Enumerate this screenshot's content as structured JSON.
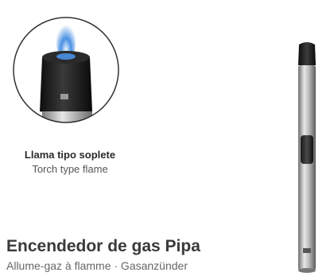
{
  "feature": {
    "title": "Llama tipo soplete",
    "subtitle": "Torch type flame"
  },
  "product": {
    "title": "Encendedor de gas Pipa",
    "subtitle": "Allume-gaz à flamme · Gasanzünder"
  },
  "colors": {
    "flame": "#4a90e2",
    "nozzle": "#1c1c1c",
    "body_metal": "#b9b9b9",
    "circle_border": "#333333"
  }
}
